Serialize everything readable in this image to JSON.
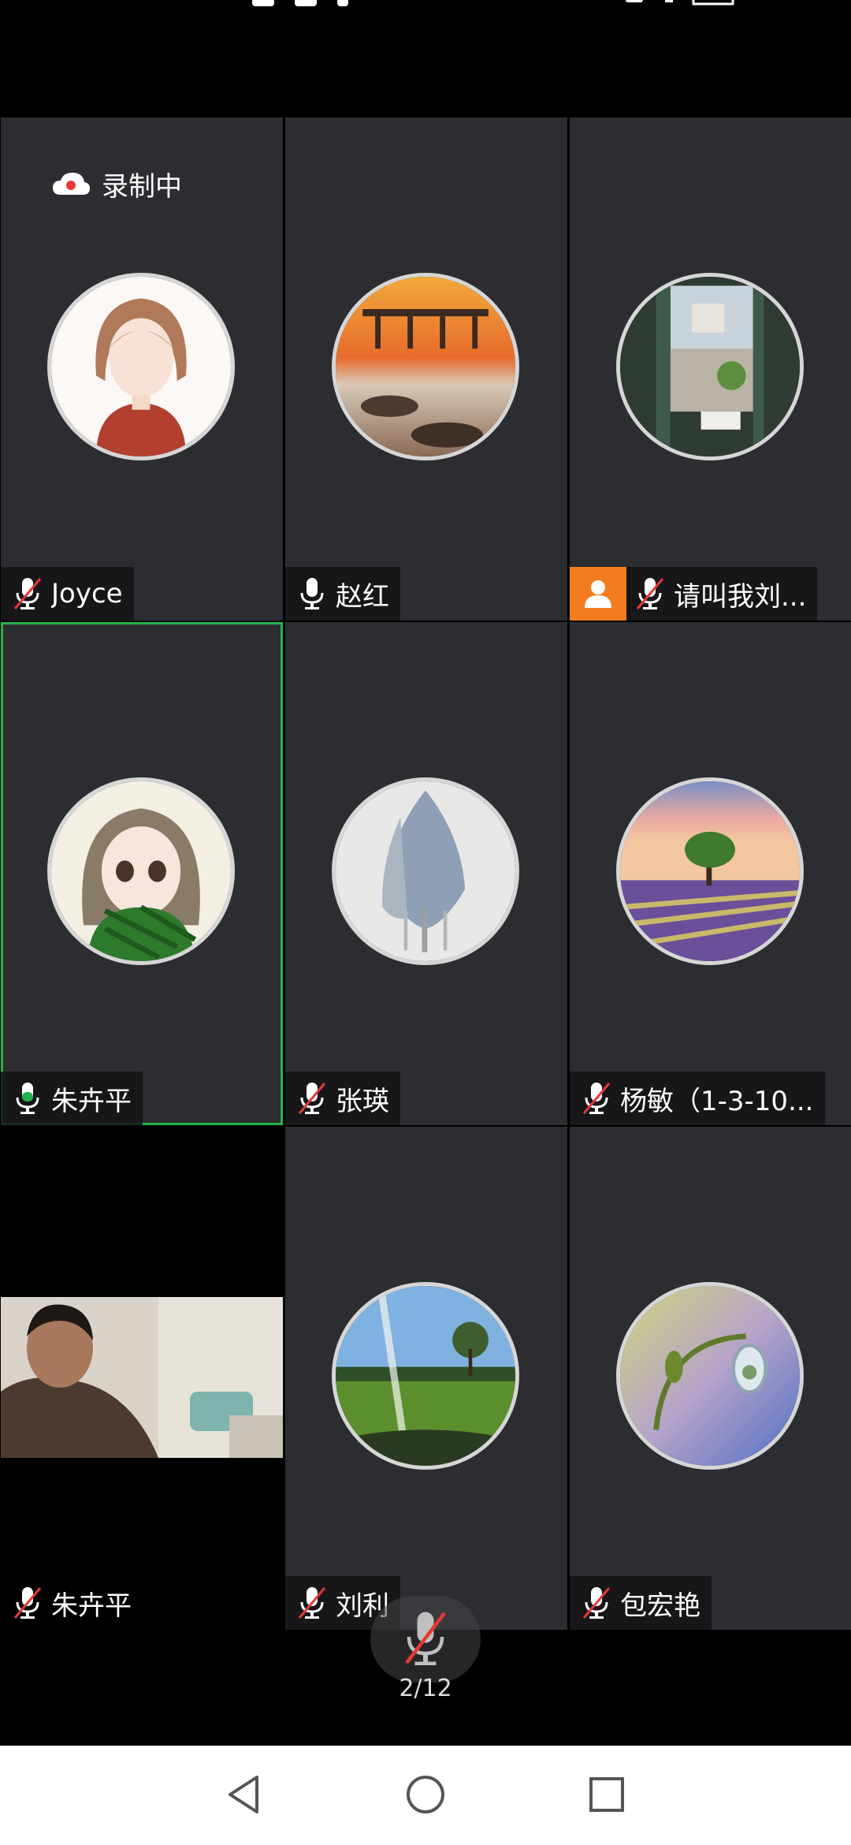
{
  "recording": {
    "label": "录制中"
  },
  "tiles": [
    {
      "name": "Joyce",
      "mic": "muted"
    },
    {
      "name": "赵红",
      "mic": "on"
    },
    {
      "name": "请叫我刘...",
      "mic": "muted",
      "host": true
    },
    {
      "name": "朱卉平",
      "mic": "speaking",
      "active": true
    },
    {
      "name": "张瑛",
      "mic": "muted"
    },
    {
      "name": "杨敏（1-3-10...",
      "mic": "muted"
    },
    {
      "name": "朱卉平",
      "mic": "muted",
      "video": true
    },
    {
      "name": "刘利",
      "mic": "muted"
    },
    {
      "name": "包宏艳",
      "mic": "muted"
    }
  ],
  "mute_button": {
    "page_indicator": "2/12"
  },
  "colors": {
    "active_border": "#25b24d",
    "host_badge": "#f47c20",
    "tile_bg": "#2c2d31",
    "mute_slash": "#e53935"
  },
  "icons": [
    "cloud-recording-icon",
    "microphone-icon",
    "microphone-muted-icon",
    "person-icon",
    "back-icon",
    "home-icon",
    "recents-icon"
  ]
}
